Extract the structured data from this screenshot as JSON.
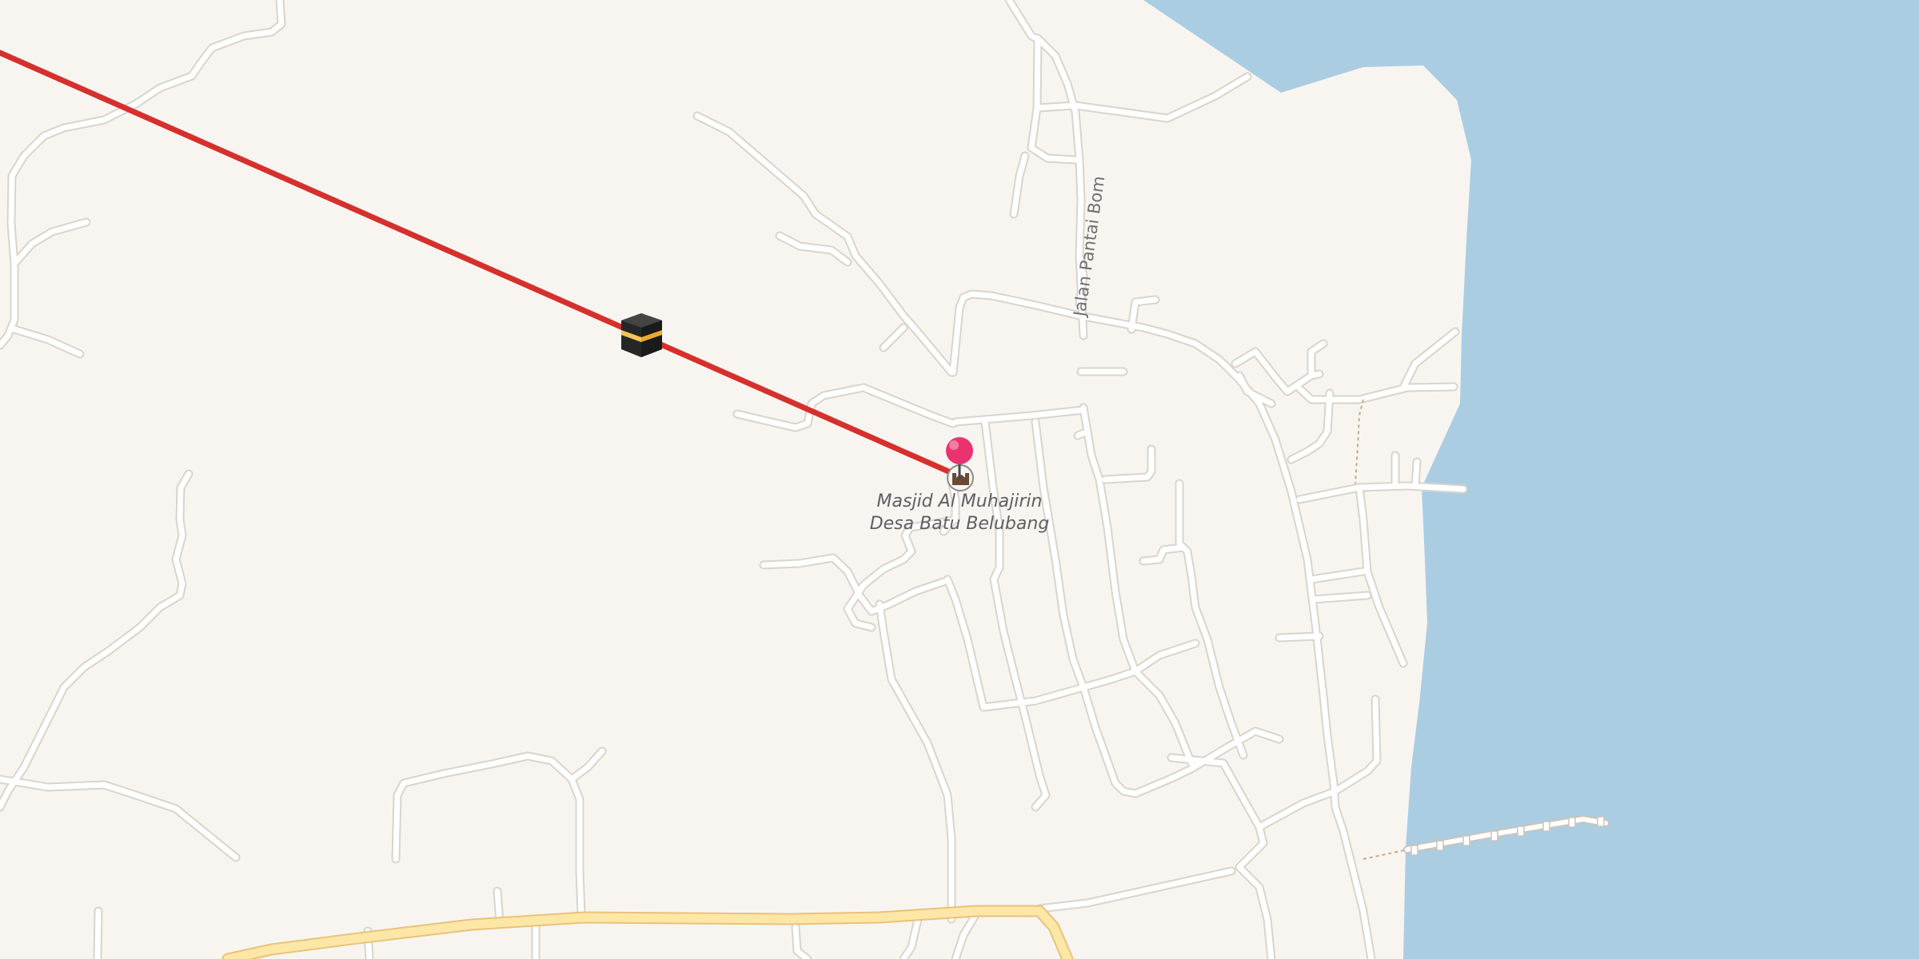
{
  "map": {
    "water_color": "#abcde2",
    "land_color": "#f8f5f1",
    "minor_road_color": "#ffffff",
    "major_road_color": "#fde7a6",
    "route_color": "#d6302c",
    "marker_color": "#e8336f"
  },
  "labels": {
    "mosque_line1": "Masjid Al Muhajirin",
    "mosque_line2": "Desa Batu Belubang",
    "road_name": "Jalan Pantai Bom"
  },
  "icons": {
    "kaaba": "kaaba-icon",
    "mosque": "mosque-icon",
    "marker": "location-pin-icon"
  }
}
